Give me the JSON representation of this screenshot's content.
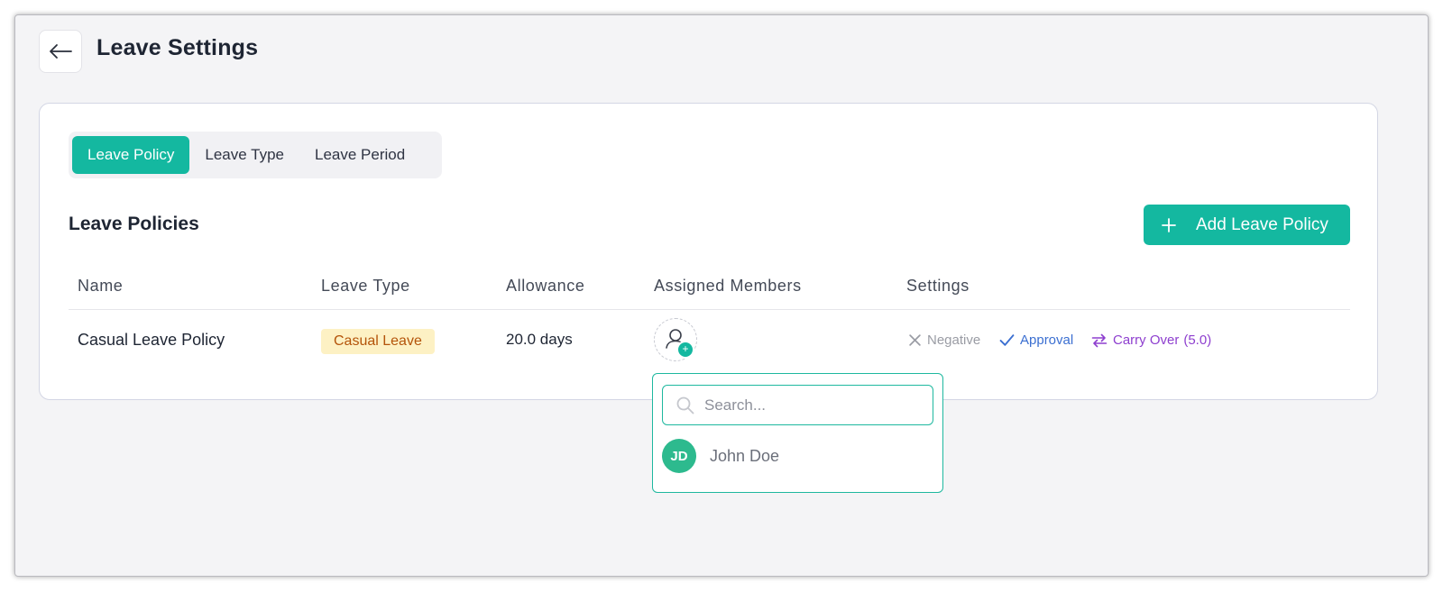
{
  "page": {
    "title": "Leave Settings"
  },
  "tabs": [
    {
      "label": "Leave Policy",
      "active": true
    },
    {
      "label": "Leave Type",
      "active": false
    },
    {
      "label": "Leave Period",
      "active": false
    }
  ],
  "section": {
    "title": "Leave Policies",
    "add_button_label": "Add Leave Policy"
  },
  "table": {
    "headers": [
      "Name",
      "Leave Type",
      "Allowance",
      "Assigned Members",
      "Settings"
    ],
    "rows": [
      {
        "name": "Casual Leave Policy",
        "leave_type": "Casual Leave",
        "allowance": "20.0 days",
        "settings": {
          "negative": "Negative",
          "approval": "Approval",
          "carry_over": "Carry Over",
          "carry_over_value": "(5.0)"
        }
      }
    ]
  },
  "member_dropdown": {
    "search_placeholder": "Search...",
    "members": [
      {
        "initials": "JD",
        "name": "John Doe"
      }
    ]
  },
  "colors": {
    "accent": "#14b8a0",
    "badge_bg": "#fdf1c4",
    "badge_text": "#b4540a",
    "approval": "#3b6fd1",
    "carry_over": "#8e3fcf",
    "negative": "#9a9ca4"
  },
  "icons": {
    "back": "arrow-left-icon",
    "add": "plus-icon",
    "member_add": "user-add-icon",
    "negative": "x-icon",
    "approval": "check-icon",
    "carry_over": "arrows-exchange-icon",
    "search": "search-icon"
  }
}
